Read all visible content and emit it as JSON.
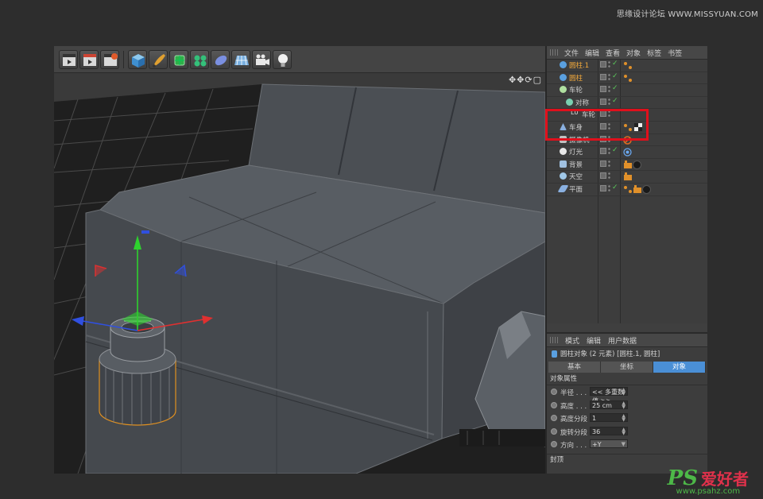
{
  "watermark": {
    "top": "思缘设计论坛 WWW.MISSYUAN.COM",
    "logo": "PS",
    "name": "爱好者",
    "url": "www.psahz.com"
  },
  "viewport": {
    "nav_icons": "✥✥⟳▢"
  },
  "object_manager": {
    "menu": [
      "文件",
      "编辑",
      "查看",
      "对象",
      "标签",
      "书签"
    ],
    "objects": [
      {
        "name": "圆柱.1",
        "selected": true,
        "indent": 1,
        "icon": "cylinder-icon",
        "checked": true,
        "tags": [
          "phong-tag-icon"
        ]
      },
      {
        "name": "圆柱",
        "selected": true,
        "indent": 1,
        "icon": "cylinder-icon",
        "checked": true,
        "tags": [
          "phong-tag-icon"
        ]
      },
      {
        "name": "车轮",
        "selected": false,
        "indent": 0,
        "icon": "null-icon",
        "checked": true,
        "tags": []
      },
      {
        "name": "对称",
        "selected": false,
        "indent": 1,
        "icon": "symmetry-icon",
        "checked": true,
        "tags": []
      },
      {
        "name": "车轮",
        "selected": false,
        "indent": 2,
        "icon": "lod-icon",
        "checked": false,
        "tags": []
      },
      {
        "name": "车身",
        "selected": false,
        "indent": 0,
        "icon": "polygon-icon",
        "checked": false,
        "tags": [
          "phong-tag-icon",
          "material-checker-icon"
        ]
      },
      {
        "name": "摄像机",
        "selected": false,
        "indent": 0,
        "icon": "camera-icon",
        "checked": false,
        "tags": [
          "camera-target-icon"
        ]
      },
      {
        "name": "灯光",
        "selected": false,
        "indent": 0,
        "icon": "light-icon",
        "checked": true,
        "tags": [
          "light-target-icon"
        ]
      },
      {
        "name": "背景",
        "selected": false,
        "indent": 0,
        "icon": "background-icon",
        "checked": false,
        "tags": [
          "compositing-tag-icon",
          "material-dark-icon"
        ]
      },
      {
        "name": "天空",
        "selected": false,
        "indent": 0,
        "icon": "sky-icon",
        "checked": false,
        "tags": [
          "compositing-tag-icon"
        ]
      },
      {
        "name": "平面",
        "selected": false,
        "indent": 0,
        "icon": "plane-icon",
        "checked": true,
        "tags": [
          "phong-tag-icon",
          "compositing-tag-icon",
          "material-dark-icon"
        ]
      }
    ]
  },
  "attributes": {
    "menu": [
      "模式",
      "编辑",
      "用户数据"
    ],
    "title": "圆柱对象 (2 元素) [圆柱.1, 圆柱]",
    "tabs": [
      {
        "label": "基本",
        "active": false
      },
      {
        "label": "坐标",
        "active": false
      },
      {
        "label": "对象",
        "active": true
      }
    ],
    "section": "对象属性",
    "properties": [
      {
        "label": "半径 . . .",
        "value": "<< 多重数值 >>",
        "type": "spinner"
      },
      {
        "label": "高度 . . .",
        "value": "25 cm",
        "type": "spinner"
      },
      {
        "label": "高度分段",
        "value": "1",
        "type": "spinner"
      },
      {
        "label": "旋转分段",
        "value": "36",
        "type": "spinner"
      },
      {
        "label": "方向 . . .",
        "value": "+Y",
        "type": "dropdown"
      }
    ],
    "section2": "封顶"
  },
  "colors": {
    "selected_name": "#f2a93b",
    "active_tab": "#4a8fd6",
    "highlight_box": "#e0101c",
    "check": "#5ac85a"
  }
}
